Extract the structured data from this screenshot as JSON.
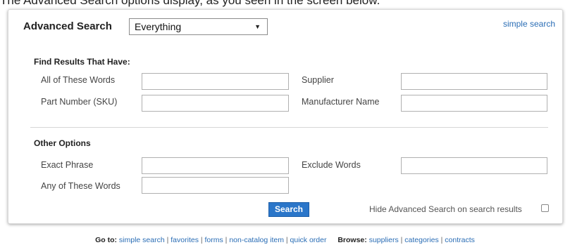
{
  "caption": "The Advanced Search options display, as you seen in the screen below.",
  "header": {
    "title": "Advanced Search",
    "scope_selected": "Everything",
    "simple_search_link": "simple search"
  },
  "find_section": {
    "title": "Find Results That Have:",
    "fields": {
      "all_words": {
        "label": "All of These Words",
        "value": ""
      },
      "supplier": {
        "label": "Supplier",
        "value": ""
      },
      "part_number": {
        "label": "Part Number (SKU)",
        "value": ""
      },
      "manufacturer": {
        "label": "Manufacturer Name",
        "value": ""
      }
    }
  },
  "other_section": {
    "title": "Other Options",
    "fields": {
      "exact_phrase": {
        "label": "Exact Phrase",
        "value": ""
      },
      "exclude_words": {
        "label": "Exclude Words",
        "value": ""
      },
      "any_words": {
        "label": "Any of These Words",
        "value": ""
      }
    }
  },
  "actions": {
    "search_label": "Search",
    "hide_label": "Hide Advanced Search on search results",
    "hide_checked": false
  },
  "footer": {
    "goto_label": "Go to:",
    "goto_links": [
      "simple search",
      "favorites",
      "forms",
      "non-catalog item",
      "quick order"
    ],
    "browse_label": "Browse:",
    "browse_links": [
      "suppliers",
      "categories",
      "contracts"
    ]
  },
  "colors": {
    "link": "#2a6db5",
    "button": "#2b76c9"
  }
}
